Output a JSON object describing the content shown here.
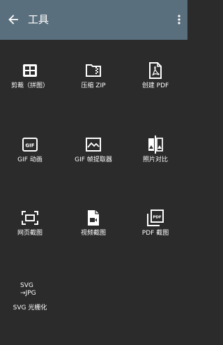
{
  "appbar": {
    "title": "工具"
  },
  "icons": {
    "back": "arrow-back-icon",
    "menu": "more-vert-icon"
  },
  "tools": [
    {
      "label": "剪裁（拼图）",
      "icon": "grid-crop-icon"
    },
    {
      "label": "压缩 ZIP",
      "icon": "zip-folder-icon"
    },
    {
      "label": "创建 PDF",
      "icon": "pdf-file-icon"
    },
    {
      "label": "GIF 动画",
      "icon": "gif-icon"
    },
    {
      "label": "GIF 帧提取器",
      "icon": "image-frame-icon"
    },
    {
      "label": "照片对比",
      "icon": "compare-icon"
    },
    {
      "label": "网页截图",
      "icon": "screenshot-icon"
    },
    {
      "label": "视频截图",
      "icon": "video-file-icon"
    },
    {
      "label": "PDF 截图",
      "icon": "pdf-box-icon"
    },
    {
      "label": "SVG 光栅化",
      "icon": "svg-to-jpg-icon"
    }
  ],
  "svg_icon_text": {
    "line1": "SVG",
    "line2": "→JPG"
  },
  "gif_badge": "GIF",
  "pdf_badge": "PDF"
}
